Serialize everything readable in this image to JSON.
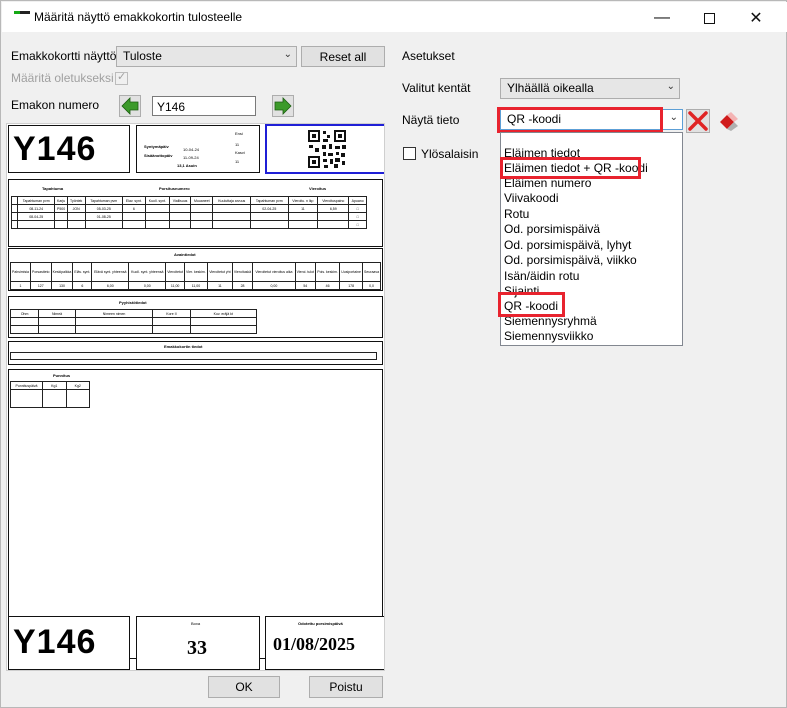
{
  "window": {
    "title": "Määritä näyttö emakkokortin tulosteelle"
  },
  "left": {
    "card_view_label": "Emakkokortti näyttö",
    "card_view_value": "Tuloste",
    "reset_label": "Reset all",
    "set_default_label": "Määritä oletukseksi",
    "sow_number_label": "Emakon numero",
    "sow_number_value": "Y146"
  },
  "preview": {
    "card_id": "Y146",
    "top_fields": [
      "Syntymäpäiv",
      "Sisäänottopäiv",
      "13,1 Asuin"
    ],
    "top_values": [
      "10-04-24",
      "11-09-24"
    ],
    "top_small": [
      "Ensi",
      "11",
      "Kasvi",
      "11"
    ],
    "table1_headers": [
      "Tapahtuma",
      "Porsitusnumero",
      "Vieroitus"
    ],
    "table1_cols": [
      "Tapahtuman pvm",
      "Karju",
      "Työntek",
      "Tapahtuman pvm",
      "Elav. synt.",
      "Kuoll. synt.",
      "Viallisuus",
      "Muuaneet",
      "Kuuluttaja arvuus",
      "Tapahtuman pvm",
      "Vieroitu. n lkp",
      "Vieroituspaino",
      "Apuano"
    ],
    "table1_rows": [
      [
        "08-11-24",
        "P500",
        "JON",
        "05-03-25",
        "6",
        "",
        "",
        "",
        "",
        "02-04-25",
        "11",
        "6,59",
        "□"
      ],
      [
        "08-04-25",
        "",
        "",
        "01-08-25",
        "",
        "",
        "",
        "",
        "",
        "",
        "",
        "",
        "□"
      ]
    ],
    "table2_title": "Avaintiedot",
    "table2_cols": [
      "Pahsimisia",
      "Porsastieto",
      "Keskipalkka",
      "Eläv. synt.",
      "Elävä synt. yhteensä",
      "Kuoll. synt. yhteensä",
      "Vieroitetut",
      "Vier. keskim.",
      "Vieroitetut yht",
      "Vieroituskä",
      "Vieroitetut vieroitus aika",
      "Vieroi. tulot",
      "Pois. keskim.",
      "Uusiportaine",
      "Seuraava"
    ],
    "table2_values": [
      "1",
      "127",
      "130",
      "6",
      "6,00",
      "0,00",
      "11,00",
      "11,00",
      "11",
      "28",
      "0,00",
      "54",
      "46",
      "178",
      "0,0"
    ],
    "table3_title": "Pyyhistötiedot",
    "table3_cols": [
      "Ohm",
      "Nimeä",
      "Nimeen nimen",
      "Kore II",
      "Kuv. eräjä kt"
    ],
    "table4_title": "Emakkokortin tiedot",
    "table5_title": "Punnitus",
    "table5_cols": [
      "Punnituspäivä",
      "Kg1",
      "Kg2"
    ],
    "bottom_id": "Y146",
    "bottom_mid_label": "Boxa",
    "bottom_mid_value": "33",
    "bottom_right_label": "Odotettu porsimispäivä",
    "bottom_right_value": "01/08/2025"
  },
  "right": {
    "settings_label": "Asetukset",
    "selected_fields_label": "Valitut kentät",
    "selected_fields_value": "Ylhäällä oikealla",
    "show_info_label": "Näytä tieto",
    "show_info_value": "QR -koodi",
    "upside_down_label": "Ylösalaisin",
    "dropdown_items": [
      "Eläimen tiedot",
      "Eläimen tiedot + QR -koodi",
      "Eläimen numero",
      "Viivakoodi",
      "Rotu",
      "Od. porsimispäivä",
      "Od. porsimispäivä, lyhyt",
      "Od. porsimispäivä, viikko",
      "Isän/äidin rotu",
      "Sijainti",
      "QR -koodi",
      "Siemennysryhmä",
      "Siemennysviikko"
    ]
  },
  "footer": {
    "ok_label": "OK",
    "close_label": "Poistu"
  },
  "colors": {
    "highlight": "#e8232e",
    "selection_border": "#1f1fd6",
    "green_arrow": "#3c9a2a"
  }
}
